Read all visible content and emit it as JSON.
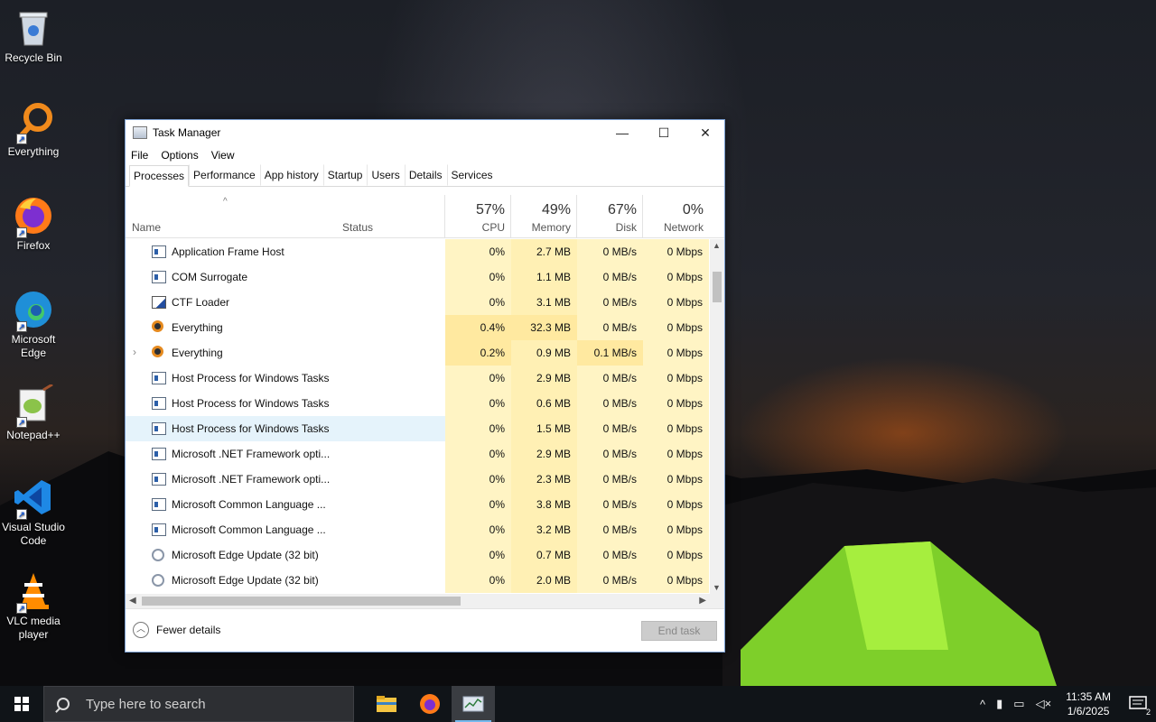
{
  "desktop": {
    "icons": [
      {
        "label": "Recycle Bin"
      },
      {
        "label": "Everything"
      },
      {
        "label": "Firefox"
      },
      {
        "label": "Microsoft Edge"
      },
      {
        "label": "Notepad++"
      },
      {
        "label": "Visual Studio Code"
      },
      {
        "label": "VLC media player"
      }
    ]
  },
  "window": {
    "title": "Task Manager",
    "controls": {
      "minimize": "—",
      "maximize": "☐",
      "close": "✕"
    },
    "menu": [
      "File",
      "Options",
      "View"
    ],
    "tabs": [
      "Processes",
      "Performance",
      "App history",
      "Startup",
      "Users",
      "Details",
      "Services"
    ],
    "active_tab": "Processes",
    "columns": {
      "name": "Name",
      "status": "Status",
      "sort_indicator": "^",
      "cpu": {
        "pct": "57%",
        "label": "CPU"
      },
      "memory": {
        "pct": "49%",
        "label": "Memory"
      },
      "disk": {
        "pct": "67%",
        "label": "Disk"
      },
      "network": {
        "pct": "0%",
        "label": "Network"
      }
    },
    "rows": [
      {
        "name": "Application Frame Host",
        "icon": "window-icon",
        "expandable": false,
        "cpu": "0%",
        "memory": "2.7 MB",
        "disk": "0 MB/s",
        "network": "0 Mbps"
      },
      {
        "name": "COM Surrogate",
        "icon": "window-icon",
        "expandable": false,
        "cpu": "0%",
        "memory": "1.1 MB",
        "disk": "0 MB/s",
        "network": "0 Mbps"
      },
      {
        "name": "CTF Loader",
        "icon": "notepad-icon",
        "expandable": false,
        "cpu": "0%",
        "memory": "3.1 MB",
        "disk": "0 MB/s",
        "network": "0 Mbps"
      },
      {
        "name": "Everything",
        "icon": "everything-icon",
        "expandable": false,
        "cpu": "0.4%",
        "memory": "32.3 MB",
        "disk": "0 MB/s",
        "network": "0 Mbps"
      },
      {
        "name": "Everything",
        "icon": "everything-icon",
        "expandable": true,
        "cpu": "0.2%",
        "memory": "0.9 MB",
        "disk": "0.1 MB/s",
        "network": "0 Mbps"
      },
      {
        "name": "Host Process for Windows Tasks",
        "icon": "window-icon",
        "expandable": false,
        "cpu": "0%",
        "memory": "2.9 MB",
        "disk": "0 MB/s",
        "network": "0 Mbps"
      },
      {
        "name": "Host Process for Windows Tasks",
        "icon": "window-icon",
        "expandable": false,
        "cpu": "0%",
        "memory": "0.6 MB",
        "disk": "0 MB/s",
        "network": "0 Mbps"
      },
      {
        "name": "Host Process for Windows Tasks",
        "icon": "window-icon",
        "expandable": false,
        "selected": true,
        "cpu": "0%",
        "memory": "1.5 MB",
        "disk": "0 MB/s",
        "network": "0 Mbps"
      },
      {
        "name": "Microsoft .NET Framework opti...",
        "icon": "window-icon",
        "expandable": false,
        "cpu": "0%",
        "memory": "2.9 MB",
        "disk": "0 MB/s",
        "network": "0 Mbps"
      },
      {
        "name": "Microsoft .NET Framework opti...",
        "icon": "window-icon",
        "expandable": false,
        "cpu": "0%",
        "memory": "2.3 MB",
        "disk": "0 MB/s",
        "network": "0 Mbps"
      },
      {
        "name": "Microsoft Common Language ...",
        "icon": "window-icon",
        "expandable": false,
        "cpu": "0%",
        "memory": "3.8 MB",
        "disk": "0 MB/s",
        "network": "0 Mbps"
      },
      {
        "name": "Microsoft Common Language ...",
        "icon": "window-icon",
        "expandable": false,
        "cpu": "0%",
        "memory": "3.2 MB",
        "disk": "0 MB/s",
        "network": "0 Mbps"
      },
      {
        "name": "Microsoft Edge Update (32 bit)",
        "icon": "update-icon",
        "expandable": false,
        "cpu": "0%",
        "memory": "0.7 MB",
        "disk": "0 MB/s",
        "network": "0 Mbps"
      },
      {
        "name": "Microsoft Edge Update (32 bit)",
        "icon": "update-icon",
        "expandable": false,
        "cpu": "0%",
        "memory": "2.0 MB",
        "disk": "0 MB/s",
        "network": "0 Mbps"
      }
    ],
    "footer": {
      "fewer_details": "Fewer details",
      "end_task": "End task"
    }
  },
  "taskbar": {
    "search_placeholder": "Type here to search",
    "apps": [
      "file-explorer-icon",
      "firefox-icon",
      "task-manager-icon"
    ],
    "clock": {
      "time": "11:35 AM",
      "date": "1/6/2025"
    },
    "notification_count": "2"
  }
}
